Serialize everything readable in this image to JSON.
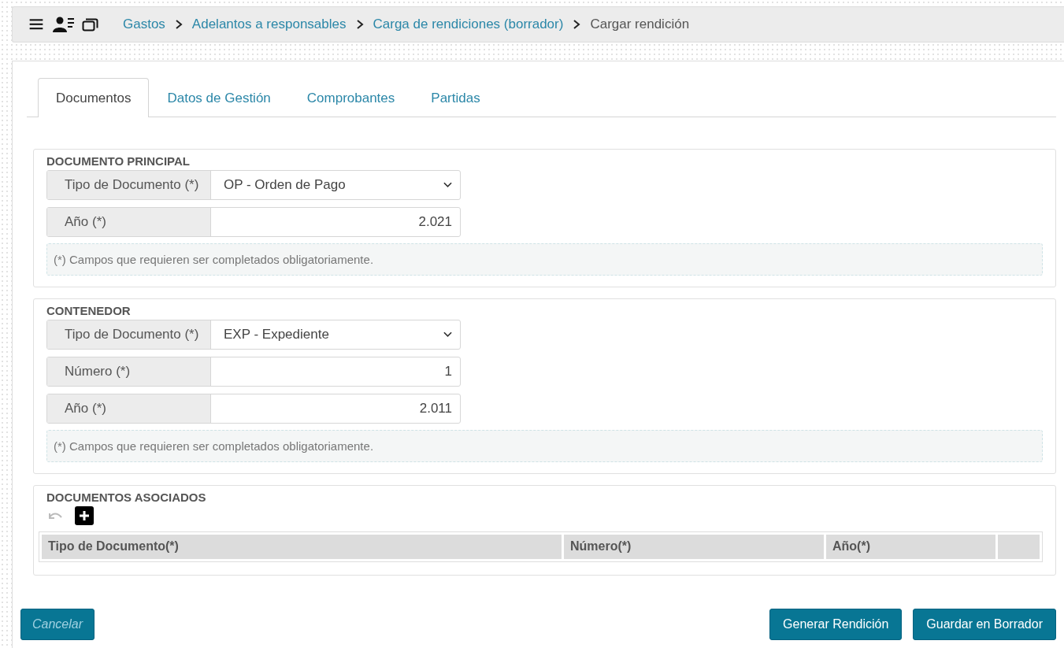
{
  "breadcrumb": [
    {
      "label": "Gastos",
      "link": true
    },
    {
      "label": "Adelantos a responsables",
      "link": true
    },
    {
      "label": "Carga de rendiciones (borrador)",
      "link": true
    },
    {
      "label": "Cargar rendición",
      "link": false
    }
  ],
  "tabs": [
    {
      "label": "Documentos",
      "selected": true
    },
    {
      "label": "Datos de Gestión",
      "selected": false
    },
    {
      "label": "Comprobantes",
      "selected": false
    },
    {
      "label": "Partidas",
      "selected": false
    }
  ],
  "sections": [
    {
      "title": "DOCUMENTO PRINCIPAL",
      "fields": [
        {
          "kind": "select",
          "label": "Tipo de Documento (*)",
          "value": "OP - Orden de Pago"
        },
        {
          "kind": "number",
          "label": "Año (*)",
          "value": "2.021"
        }
      ],
      "note": "(*) Campos que requieren ser completados obligatoriamente."
    },
    {
      "title": "CONTENEDOR",
      "fields": [
        {
          "kind": "select",
          "label": "Tipo de Documento (*)",
          "value": "EXP - Expediente"
        },
        {
          "kind": "number",
          "label": "Número (*)",
          "value": "1"
        },
        {
          "kind": "number",
          "label": "Año (*)",
          "value": "2.011"
        }
      ],
      "note": "(*) Campos que requieren ser completados obligatoriamente."
    }
  ],
  "associated": {
    "title": "DOCUMENTOS ASOCIADOS",
    "columns": [
      "Tipo de Documento(*)",
      "Número(*)",
      "Año(*)"
    ]
  },
  "buttons": [
    {
      "label": "Cancelar",
      "kind": "secondary"
    },
    {
      "label": "Generar Rendición",
      "kind": "primary"
    },
    {
      "label": "Guardar en Borrador",
      "kind": "primary"
    }
  ]
}
